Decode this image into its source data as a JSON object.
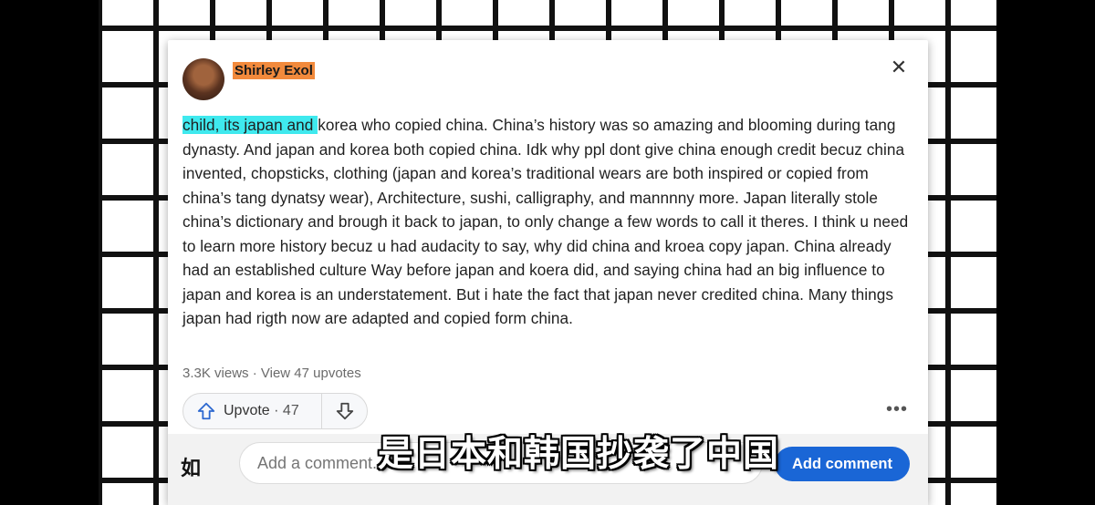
{
  "post": {
    "author": "Shirley Exol",
    "body_highlight": "child, its japan and ",
    "body_rest": "korea who copied china. China’s history was so amazing and blooming during tang dynasty. And japan and korea both copied china. Idk why ppl dont give china enough credit becuz china invented, chopsticks, clothing (japan and korea’s traditional wears are both inspired or copied from china’s tang dynatsy wear), Architecture, sushi, calligraphy, and mannnny more. Japan literally stole china’s dictionary and brough it back to japan, to only change a few words to call it theres. I think u need to learn more history becuz u had audacity to say, why did china and kroea copy japan. China already had an established culture Way before japan and koera did, and saying china had an big influence to japan and korea is an understatement. But i hate the fact that japan never credited china. Many things japan had rigth now are adapted and copied form china.",
    "views": "3.3K views",
    "separator": " · ",
    "upvotes_link": "View 47 upvotes",
    "highlight_color": "#3fe9ee",
    "author_highlight_color": "#f28a3c"
  },
  "actions": {
    "upvote_label": "Upvote",
    "upvote_count": "· 47",
    "more_label": "•••"
  },
  "comment": {
    "avatar_text": "如",
    "placeholder": "Add a comment...",
    "submit_label": "Add comment",
    "accent": "#1a66d6"
  },
  "overlay": {
    "subtitle": "是日本和韩国抄袭了中国"
  },
  "icons": {
    "close": "close-icon",
    "upvote": "arrow-up-icon",
    "downvote": "arrow-down-icon",
    "more": "more-icon"
  }
}
